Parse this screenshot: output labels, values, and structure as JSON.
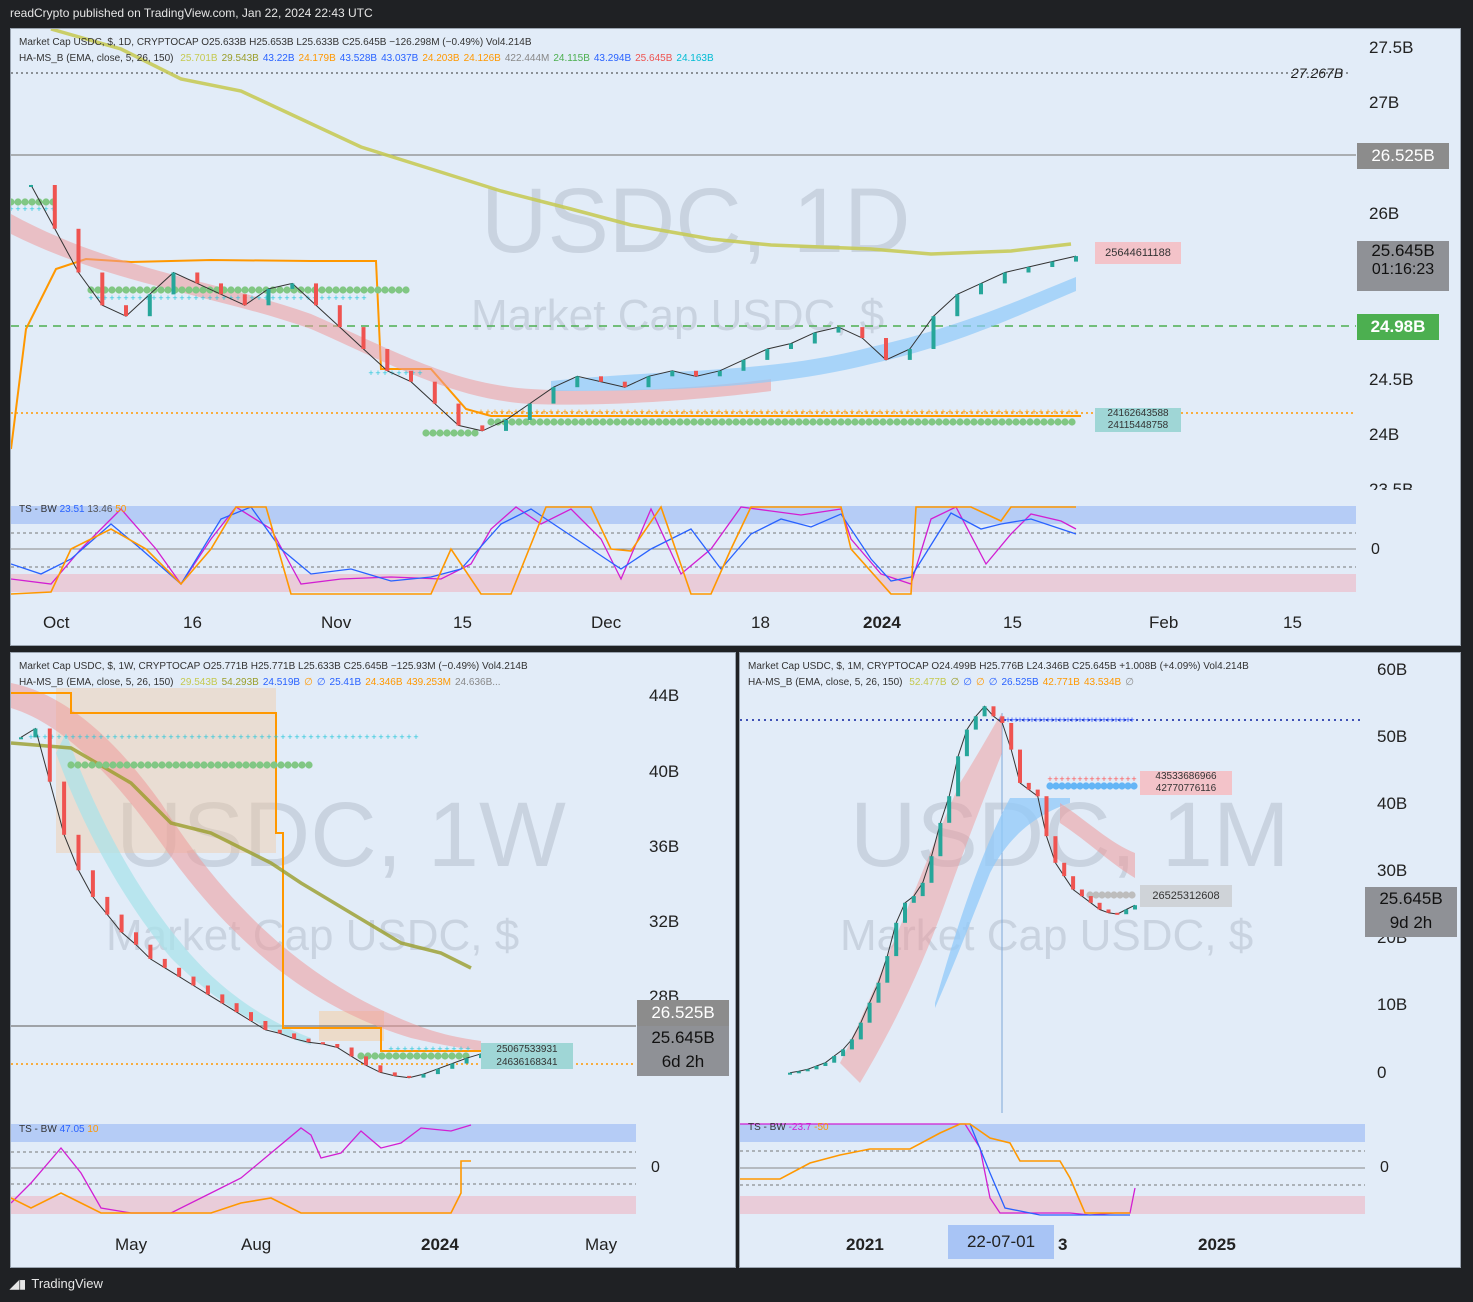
{
  "header": {
    "publisher": "readCrypto published on TradingView.com, Jan 22, 2024 22:43 UTC"
  },
  "footer": {
    "brand": "TradingView"
  },
  "colors": {
    "accent_green": "#4caf50",
    "price_grey": "#9598a1",
    "line_orange": "#ff9800",
    "line_olive": "#c5c94f",
    "ema_red": "#ef9a9a",
    "ema_blue": "#90caf9"
  },
  "panel_daily": {
    "legend1": "Market Cap USDC, $, 1D, CRYPTOCAP  O25.633B  H25.653B  L25.633B  C25.645B  −126.298M (−0.49%)  Vol4.214B",
    "legend2_label": "HA-MS_B (EMA, close, 5, 26, 150)",
    "legend2_values": [
      "25.701B",
      "29.543B",
      "43.22B",
      "24.179B",
      "43.528B",
      "43.037B",
      "24.203B",
      "24.126B",
      "422.444M",
      "24.115B",
      "43.294B",
      "25.645B",
      "24.163B"
    ],
    "watermark_big": "USDC, 1D",
    "watermark_small": "Market Cap USDC, $",
    "yaxis": [
      "27.5B",
      "27B",
      "26B",
      "24.5B",
      "24B",
      "23.5B"
    ],
    "dotted_label": "27.267B",
    "level_label": "26.525B",
    "price": "25.645B",
    "countdown": "01:16:23",
    "green_level": "24.98B",
    "tag1": "25644611188",
    "tag2": "24162643588",
    "tag3": "24115448758",
    "osc_label": "TS - BW",
    "osc_values": [
      "23.51",
      "13.46",
      "50"
    ],
    "osc_zero": "0",
    "xaxis": [
      "Oct",
      "16",
      "Nov",
      "15",
      "Dec",
      "18",
      "2024",
      "15",
      "Feb",
      "15"
    ]
  },
  "panel_weekly": {
    "legend1": "Market Cap USDC, $, 1W, CRYPTOCAP  O25.771B  H25.771B  L25.633B  C25.645B  −125.93M (−0.49%)  Vol4.214B",
    "legend2_label": "HA-MS_B (EMA, close, 5, 26, 150)",
    "legend2_values": [
      "29.543B",
      "54.293B",
      "24.519B",
      "∅",
      "∅",
      "25.41B",
      "24.346B",
      "439.253M",
      "24.636B..."
    ],
    "watermark_big": "USDC, 1W",
    "watermark_small": "Market Cap USDC, $",
    "yaxis": [
      "44B",
      "40B",
      "36B",
      "32B",
      "28B"
    ],
    "level_label": "26.525B",
    "price": "25.645B",
    "countdown": "6d 2h",
    "tag1": "25067533931",
    "tag2": "24636168341",
    "osc_label": "TS - BW",
    "osc_values": [
      "47.05",
      "10"
    ],
    "osc_zero": "0",
    "xaxis": [
      "May",
      "Aug",
      "2024",
      "May"
    ]
  },
  "panel_monthly": {
    "legend1": "Market Cap USDC, $, 1M, CRYPTOCAP  O24.499B  H25.776B  L24.346B  C25.645B  +1.008B (+4.09%)  Vol4.214B",
    "legend2_label": "HA-MS_B (EMA, close, 5, 26, 150)",
    "legend2_values": [
      "52.477B",
      "∅",
      "∅",
      "∅",
      "∅",
      "26.525B",
      "42.771B",
      "43.534B",
      "∅"
    ],
    "watermark_big": "USDC, 1M",
    "watermark_small": "Market Cap USDC, $",
    "yaxis": [
      "60B",
      "50B",
      "40B",
      "30B",
      "20B",
      "10B",
      "0"
    ],
    "price": "25.645B",
    "countdown": "9d 2h",
    "tag1": "43533686966",
    "tag2": "42770776116",
    "tag3": "26525312608",
    "osc_label": "TS - BW",
    "osc_values": [
      "-23.7",
      "-50"
    ],
    "osc_zero": "0",
    "xaxis": [
      "2021",
      "22-07-01",
      "3",
      "2025"
    ]
  },
  "chart_data": [
    {
      "type": "line",
      "title": "USDC, 1D",
      "series": [
        {
          "name": "Market Cap USDC, $",
          "values": [
            26.3,
            25.9,
            25.5,
            25.2,
            25.1,
            25.3,
            25.5,
            25.4,
            25.3,
            25.2,
            25.35,
            25.4,
            25.2,
            25.0,
            24.8,
            24.6,
            24.5,
            24.3,
            24.1,
            24.05,
            24.15,
            24.3,
            24.45,
            24.55,
            24.5,
            24.45,
            24.55,
            24.6,
            24.55,
            24.6,
            24.7,
            24.8,
            24.85,
            24.95,
            25.0,
            24.9,
            24.7,
            24.8,
            25.1,
            25.3,
            25.4,
            25.5,
            25.55,
            25.6,
            25.65
          ]
        }
      ],
      "ylim": [
        23.5,
        27.6
      ]
    },
    {
      "type": "line",
      "title": "USDC, 1W",
      "series": [
        {
          "name": "Market Cap USDC, $",
          "values": [
            43.5,
            44.0,
            41.0,
            38.0,
            36.0,
            34.5,
            33.5,
            32.5,
            31.8,
            31.0,
            30.5,
            30.0,
            29.5,
            29.0,
            28.5,
            28.0,
            27.5,
            27.0,
            26.8,
            26.5,
            26.3,
            26.2,
            26.0,
            25.5,
            25.0,
            24.6,
            24.4,
            24.3,
            24.5,
            24.8,
            25.1,
            25.4,
            25.645
          ]
        }
      ],
      "ylim": [
        24,
        46
      ]
    },
    {
      "type": "line",
      "title": "USDC, 1M",
      "series": [
        {
          "name": "Market Cap USDC, $",
          "values": [
            0.5,
            0.7,
            1.0,
            1.5,
            2.0,
            3.0,
            4.0,
            5.5,
            8.0,
            11.0,
            14.0,
            18.0,
            23.0,
            26.0,
            27.0,
            29.0,
            33.0,
            38.0,
            42.0,
            48.0,
            52.0,
            54.0,
            55.5,
            54.0,
            53.0,
            49.0,
            44.0,
            43.0,
            42.0,
            36.0,
            32.0,
            30.0,
            28.0,
            27.0,
            26.0,
            25.0,
            24.5,
            24.3,
            25.0,
            25.645
          ]
        }
      ],
      "ylim": [
        0,
        62
      ]
    }
  ]
}
